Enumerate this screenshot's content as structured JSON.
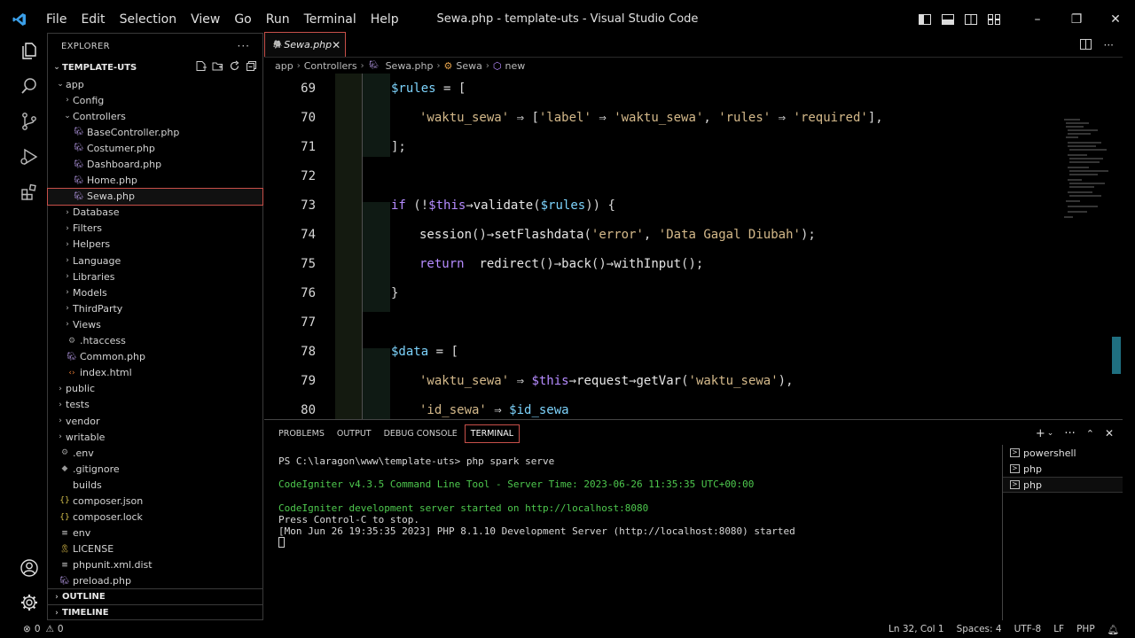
{
  "titlebar": {
    "menu": [
      "File",
      "Edit",
      "Selection",
      "View",
      "Go",
      "Run",
      "Terminal",
      "Help"
    ],
    "window_title": "Sewa.php - template-uts - Visual Studio Code",
    "minimize": "–",
    "restore": "❐",
    "close": "✕"
  },
  "sidebar": {
    "header": "EXPLORER",
    "more": "···",
    "folder": "TEMPLATE-UTS",
    "tree": [
      {
        "label": "app",
        "depth": 0,
        "type": "folder-open"
      },
      {
        "label": "Config",
        "depth": 1,
        "type": "folder"
      },
      {
        "label": "Controllers",
        "depth": 1,
        "type": "folder-open"
      },
      {
        "label": "BaseController.php",
        "depth": 2,
        "type": "php"
      },
      {
        "label": "Costumer.php",
        "depth": 2,
        "type": "php"
      },
      {
        "label": "Dashboard.php",
        "depth": 2,
        "type": "php"
      },
      {
        "label": "Home.php",
        "depth": 2,
        "type": "php"
      },
      {
        "label": "Sewa.php",
        "depth": 2,
        "type": "php",
        "selected": true
      },
      {
        "label": "Database",
        "depth": 1,
        "type": "folder"
      },
      {
        "label": "Filters",
        "depth": 1,
        "type": "folder"
      },
      {
        "label": "Helpers",
        "depth": 1,
        "type": "folder"
      },
      {
        "label": "Language",
        "depth": 1,
        "type": "folder"
      },
      {
        "label": "Libraries",
        "depth": 1,
        "type": "folder"
      },
      {
        "label": "Models",
        "depth": 1,
        "type": "folder"
      },
      {
        "label": "ThirdParty",
        "depth": 1,
        "type": "folder"
      },
      {
        "label": "Views",
        "depth": 1,
        "type": "folder"
      },
      {
        "label": ".htaccess",
        "depth": 1,
        "type": "gear"
      },
      {
        "label": "Common.php",
        "depth": 1,
        "type": "php"
      },
      {
        "label": "index.html",
        "depth": 1,
        "type": "html"
      },
      {
        "label": "public",
        "depth": 0,
        "type": "folder"
      },
      {
        "label": "tests",
        "depth": 0,
        "type": "folder"
      },
      {
        "label": "vendor",
        "depth": 0,
        "type": "folder"
      },
      {
        "label": "writable",
        "depth": 0,
        "type": "folder"
      },
      {
        "label": ".env",
        "depth": 0,
        "type": "gear"
      },
      {
        "label": ".gitignore",
        "depth": 0,
        "type": "dot"
      },
      {
        "label": "builds",
        "depth": 0,
        "type": "plain"
      },
      {
        "label": "composer.json",
        "depth": 0,
        "type": "json"
      },
      {
        "label": "composer.lock",
        "depth": 0,
        "type": "json"
      },
      {
        "label": "env",
        "depth": 0,
        "type": "lines"
      },
      {
        "label": "LICENSE",
        "depth": 0,
        "type": "license"
      },
      {
        "label": "phpunit.xml.dist",
        "depth": 0,
        "type": "lines"
      },
      {
        "label": "preload.php",
        "depth": 0,
        "type": "php"
      }
    ],
    "outline": "OUTLINE",
    "timeline": "TIMELINE"
  },
  "editor": {
    "tab_label": "Sewa.php",
    "breadcrumb": [
      "app",
      "Controllers",
      "Sewa.php",
      "Sewa",
      "new"
    ],
    "lines": [
      {
        "n": "69",
        "indent": 2,
        "tokens": [
          [
            "var",
            "$rules"
          ],
          [
            "op",
            " = ["
          ]
        ]
      },
      {
        "n": "70",
        "indent": 3,
        "tokens": [
          [
            "str",
            "'waktu_sewa'"
          ],
          [
            "op",
            " ⇒ ["
          ],
          [
            "str",
            "'label'"
          ],
          [
            "op",
            " ⇒ "
          ],
          [
            "str",
            "'waktu_sewa'"
          ],
          [
            "op",
            ", "
          ],
          [
            "str",
            "'rules'"
          ],
          [
            "op",
            " ⇒ "
          ],
          [
            "str",
            "'required'"
          ],
          [
            "op",
            "],"
          ]
        ]
      },
      {
        "n": "71",
        "indent": 2,
        "tokens": [
          [
            "op",
            "];"
          ]
        ]
      },
      {
        "n": "72",
        "indent": 0,
        "tokens": []
      },
      {
        "n": "73",
        "indent": 2,
        "tokens": [
          [
            "kw",
            "if"
          ],
          [
            "op",
            " (!"
          ],
          [
            "this",
            "$this"
          ],
          [
            "op",
            "→"
          ],
          [
            "fn",
            "validate"
          ],
          [
            "op",
            "("
          ],
          [
            "var",
            "$rules"
          ],
          [
            "op",
            ")) {"
          ]
        ]
      },
      {
        "n": "74",
        "indent": 3,
        "tokens": [
          [
            "fn",
            "session"
          ],
          [
            "op",
            "()→"
          ],
          [
            "fn",
            "setFlashdata"
          ],
          [
            "op",
            "("
          ],
          [
            "str",
            "'error'"
          ],
          [
            "op",
            ", "
          ],
          [
            "str",
            "'Data Gagal Diubah'"
          ],
          [
            "op",
            ");"
          ]
        ]
      },
      {
        "n": "75",
        "indent": 3,
        "tokens": [
          [
            "kw",
            "return"
          ],
          [
            "op",
            "  "
          ],
          [
            "fn",
            "redirect"
          ],
          [
            "op",
            "()→"
          ],
          [
            "fn",
            "back"
          ],
          [
            "op",
            "()→"
          ],
          [
            "fn",
            "withInput"
          ],
          [
            "op",
            "();"
          ]
        ]
      },
      {
        "n": "76",
        "indent": 2,
        "tokens": [
          [
            "op",
            "}"
          ]
        ]
      },
      {
        "n": "77",
        "indent": 0,
        "tokens": []
      },
      {
        "n": "78",
        "indent": 2,
        "tokens": [
          [
            "var",
            "$data"
          ],
          [
            "op",
            " = ["
          ]
        ]
      },
      {
        "n": "79",
        "indent": 3,
        "tokens": [
          [
            "str",
            "'waktu_sewa'"
          ],
          [
            "op",
            " ⇒ "
          ],
          [
            "this",
            "$this"
          ],
          [
            "op",
            "→"
          ],
          [
            "fn",
            "request"
          ],
          [
            "op",
            "→"
          ],
          [
            "fn",
            "getVar"
          ],
          [
            "op",
            "("
          ],
          [
            "str",
            "'waktu_sewa'"
          ],
          [
            "op",
            "),"
          ]
        ]
      },
      {
        "n": "80",
        "indent": 3,
        "tokens": [
          [
            "str",
            "'id_sewa'"
          ],
          [
            "op",
            " ⇒ "
          ],
          [
            "var",
            "$id_sewa"
          ]
        ]
      }
    ]
  },
  "panel": {
    "tabs": [
      "PROBLEMS",
      "OUTPUT",
      "DEBUG CONSOLE",
      "TERMINAL"
    ],
    "active_tab": "TERMINAL",
    "terminal_lines": [
      {
        "text": "PS C:\\laragon\\www\\template-uts> php spark serve",
        "style": "normal"
      },
      {
        "text": "",
        "style": "normal"
      },
      {
        "text": "CodeIgniter v4.3.5 Command Line Tool - Server Time: 2023-06-26 11:35:35 UTC+00:00",
        "style": "green"
      },
      {
        "text": "",
        "style": "normal"
      },
      {
        "text": "CodeIgniter development server started on http://localhost:8080",
        "style": "green"
      },
      {
        "text": "Press Control-C to stop.",
        "style": "normal"
      },
      {
        "text": "[Mon Jun 26 19:35:35 2023] PHP 8.1.10 Development Server (http://localhost:8080) started",
        "style": "normal"
      }
    ],
    "terminals": [
      {
        "label": "powershell",
        "selected": false
      },
      {
        "label": "php",
        "selected": false
      },
      {
        "label": "php",
        "selected": true
      }
    ]
  },
  "statusbar": {
    "errors": "0",
    "warnings": "0",
    "position": "Ln 32, Col 1",
    "spaces": "Spaces: 4",
    "encoding": "UTF-8",
    "eol": "LF",
    "language": "PHP"
  },
  "colors": {
    "accent_border": "#c8504a",
    "string": "#d4b98a",
    "variable": "#7dd3fc",
    "keyword": "#b58bff",
    "terminal_green": "#4ec94e"
  }
}
